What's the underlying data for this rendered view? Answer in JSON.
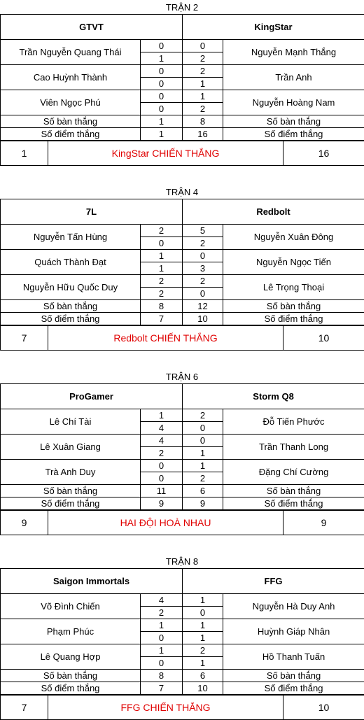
{
  "labels": {
    "goals": "Số bàn thắng",
    "points": "Số điểm thắng"
  },
  "matches": [
    {
      "title": "TRẬN 2",
      "team_left": "GTVT",
      "team_right": "KingStar",
      "players": [
        {
          "left": "Trần Nguyễn Quang Thái",
          "right": "Nguyễn Mạnh Thắng",
          "l1": "0",
          "l2": "1",
          "r1": "0",
          "r2": "2"
        },
        {
          "left": "Cao Huỳnh Thành",
          "right": "Trần Anh",
          "l1": "0",
          "l2": "0",
          "r1": "2",
          "r2": "1"
        },
        {
          "left": "Viên Ngọc Phú",
          "right": "Nguyễn Hoàng Nam",
          "l1": "0",
          "l2": "0",
          "r1": "1",
          "r2": "2"
        }
      ],
      "goals_left": "1",
      "goals_right": "8",
      "points_left": "1",
      "points_right": "16",
      "final_left": "1",
      "final_right": "16",
      "result": "KingStar CHIẾN THẮNG"
    },
    {
      "title": "TRẬN 4",
      "team_left": "7L",
      "team_right": "Redbolt",
      "players": [
        {
          "left": "Nguyễn Tấn Hùng",
          "right": "Nguyễn Xuân Đông",
          "l1": "2",
          "l2": "0",
          "r1": "5",
          "r2": "2"
        },
        {
          "left": "Quách Thành Đạt",
          "right": "Nguyễn Ngọc Tiến",
          "l1": "1",
          "l2": "1",
          "r1": "0",
          "r2": "3"
        },
        {
          "left": "Nguyễn Hữu Quốc Duy",
          "right": "Lê Trọng Thoại",
          "l1": "2",
          "l2": "2",
          "r1": "2",
          "r2": "0"
        }
      ],
      "goals_left": "8",
      "goals_right": "12",
      "points_left": "7",
      "points_right": "10",
      "final_left": "7",
      "final_right": "10",
      "result": "Redbolt CHIẾN THẮNG"
    },
    {
      "title": "TRẬN 6",
      "team_left": "ProGamer",
      "team_right": "Storm Q8",
      "players": [
        {
          "left": "Lê Chí Tài",
          "right": "Đỗ Tiến Phước",
          "l1": "1",
          "l2": "4",
          "r1": "2",
          "r2": "0"
        },
        {
          "left": "Lê Xuân Giang",
          "right": "Trần Thanh Long",
          "l1": "4",
          "l2": "2",
          "r1": "0",
          "r2": "1"
        },
        {
          "left": "Trà Anh Duy",
          "right": "Đặng Chí Cường",
          "l1": "0",
          "l2": "0",
          "r1": "1",
          "r2": "2"
        }
      ],
      "goals_left": "11",
      "goals_right": "6",
      "points_left": "9",
      "points_right": "9",
      "final_left": "9",
      "final_right": "9",
      "result": "HAI ĐỘI HOÀ NHAU"
    },
    {
      "title": "TRẬN 8",
      "team_left": "Saigon Immortals",
      "team_right": "FFG",
      "players": [
        {
          "left": "Võ Đình Chiến",
          "right": "Nguyễn Hà Duy Anh",
          "l1": "4",
          "l2": "2",
          "r1": "1",
          "r2": "0"
        },
        {
          "left": "Phạm Phúc",
          "right": "Huỳnh Giáp Nhân",
          "l1": "1",
          "l2": "0",
          "r1": "1",
          "r2": "1"
        },
        {
          "left": "Lê Quang Hợp",
          "right": "Hồ Thanh Tuấn",
          "l1": "1",
          "l2": "0",
          "r1": "2",
          "r2": "1"
        }
      ],
      "goals_left": "8",
      "goals_right": "6",
      "points_left": "7",
      "points_right": "10",
      "final_left": "7",
      "final_right": "10",
      "result": "FFG CHIẾN THẮNG"
    }
  ]
}
